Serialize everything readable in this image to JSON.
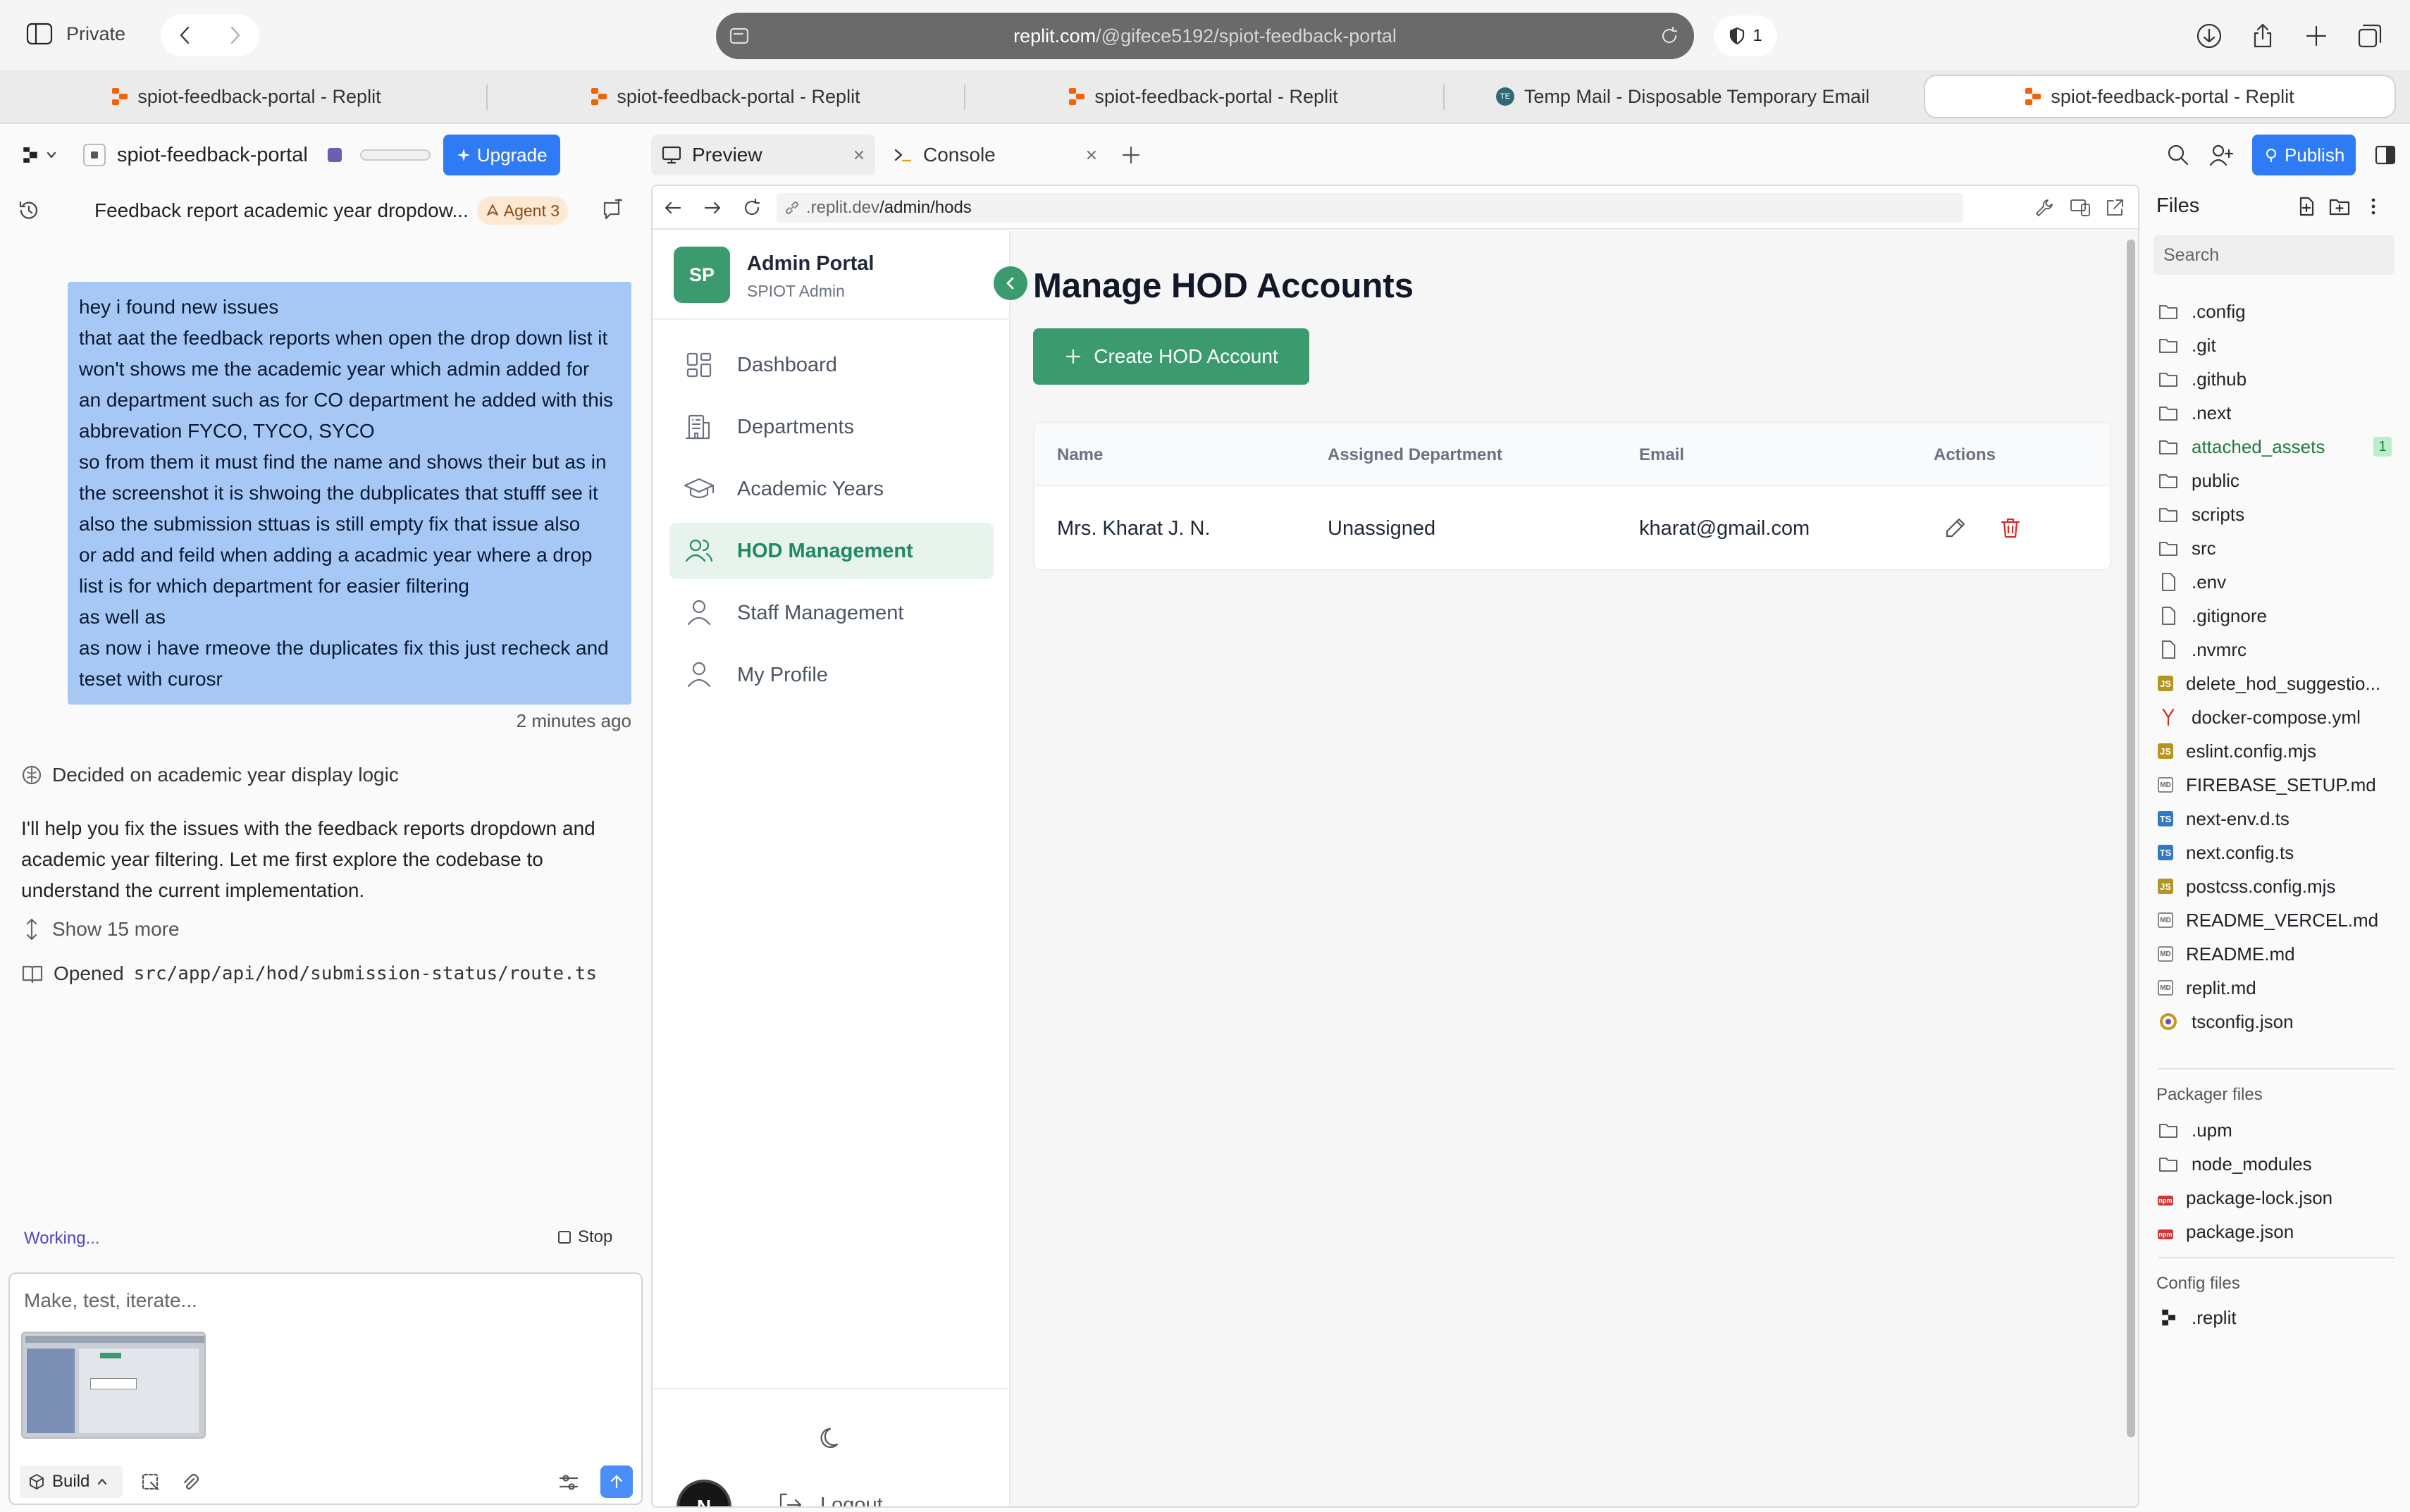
{
  "browser": {
    "private_label": "Private",
    "url_domain": "replit.com",
    "url_path": "/@gifece5192/spiot-feedback-portal",
    "shield_count": "1",
    "tabs": [
      {
        "label": "spiot-feedback-portal - Replit"
      },
      {
        "label": "spiot-feedback-portal - Replit"
      },
      {
        "label": "spiot-feedback-portal - Replit"
      },
      {
        "label": "Temp Mail - Disposable Temporary Email"
      },
      {
        "label": "spiot-feedback-portal - Replit"
      }
    ]
  },
  "workspace": {
    "project_name": "spiot-feedback-portal",
    "upgrade_label": "Upgrade",
    "publish_label": "Publish",
    "preview_tab": "Preview",
    "console_tab": "Console"
  },
  "chat": {
    "title": "Feedback report academic year dropdow...",
    "agent_badge": "Agent 3",
    "user_message": [
      "hey i found new issues",
      "that aat the feedback reports when open the drop down list it",
      "won't shows me the academic year which admin added for",
      "an department such as for CO department he added with this",
      "abbrevation FYCO, TYCO, SYCO",
      "so from them it must find the name and shows their but as in",
      "the screenshot it is shwoing the dubplicates that stufff see it",
      "also the submission sttuas is still empty fix that issue also",
      "or add and feild when adding a acadmic year where a drop",
      "list is for which department for easier filtering",
      "as well as",
      "as now i have rmeove the duplicates fix this just recheck and",
      "teset with curosr"
    ],
    "timestamp": "2 minutes ago",
    "decision": "Decided on academic year display logic",
    "reply": [
      "I'll help you fix the issues with the feedback reports dropdown and",
      "academic year filtering. Let me first explore the codebase to",
      "understand the current implementation."
    ],
    "show_more": "Show 15 more",
    "opened_prefix": "Opened",
    "opened_path": "src/app/api/hod/submission-status/route.ts",
    "working": "Working...",
    "stop": "Stop",
    "input_placeholder": "Make, test, iterate...",
    "build_label": "Build"
  },
  "preview": {
    "url_prefix": ".replit.dev",
    "url_path": "/admin/hods",
    "brand": {
      "initials": "SP",
      "title": "Admin Portal",
      "subtitle": "SPIOT Admin"
    },
    "nav": [
      {
        "label": "Dashboard",
        "icon": "grid-icon"
      },
      {
        "label": "Departments",
        "icon": "building-icon"
      },
      {
        "label": "Academic Years",
        "icon": "graduation-cap-icon"
      },
      {
        "label": "HOD Management",
        "icon": "users-icon",
        "active": true
      },
      {
        "label": "Staff Management",
        "icon": "user-icon"
      },
      {
        "label": "My Profile",
        "icon": "user-icon"
      }
    ],
    "logout": "Logout",
    "avatar_letter": "N",
    "page_title": "Manage HOD Accounts",
    "create_button": "Create HOD Account",
    "table": {
      "headers": [
        "Name",
        "Assigned Department",
        "Email",
        "Actions"
      ],
      "rows": [
        {
          "name": "Mrs. Kharat J. N.",
          "department": "Unassigned",
          "email": "kharat@gmail.com"
        }
      ]
    }
  },
  "files": {
    "title": "Files",
    "search_placeholder": "Search",
    "items": [
      {
        "name": ".config",
        "type": "folder"
      },
      {
        "name": ".git",
        "type": "folder"
      },
      {
        "name": ".github",
        "type": "folder"
      },
      {
        "name": ".next",
        "type": "folder"
      },
      {
        "name": "attached_assets",
        "type": "folder",
        "badge": "1"
      },
      {
        "name": "public",
        "type": "folder"
      },
      {
        "name": "scripts",
        "type": "folder"
      },
      {
        "name": "src",
        "type": "folder"
      },
      {
        "name": ".env",
        "type": "file"
      },
      {
        "name": ".gitignore",
        "type": "file"
      },
      {
        "name": ".nvmrc",
        "type": "file"
      },
      {
        "name": "delete_hod_suggestio...",
        "type": "js"
      },
      {
        "name": "docker-compose.yml",
        "type": "yml"
      },
      {
        "name": "eslint.config.mjs",
        "type": "js"
      },
      {
        "name": "FIREBASE_SETUP.md",
        "type": "md"
      },
      {
        "name": "next-env.d.ts",
        "type": "ts"
      },
      {
        "name": "next.config.ts",
        "type": "ts"
      },
      {
        "name": "postcss.config.mjs",
        "type": "js"
      },
      {
        "name": "README_VERCEL.md",
        "type": "md"
      },
      {
        "name": "README.md",
        "type": "md"
      },
      {
        "name": "replit.md",
        "type": "md"
      },
      {
        "name": "tsconfig.json",
        "type": "json"
      }
    ],
    "packager_title": "Packager files",
    "packager": [
      {
        "name": ".upm",
        "type": "folder"
      },
      {
        "name": "node_modules",
        "type": "folder"
      },
      {
        "name": "package-lock.json",
        "type": "npm"
      },
      {
        "name": "package.json",
        "type": "npm"
      }
    ],
    "config_title": "Config files",
    "config": [
      {
        "name": ".replit",
        "type": "replit"
      }
    ]
  },
  "colors": {
    "accent": "#3b9b6f",
    "brand_blue": "#2f7bf5",
    "danger": "#dc2626",
    "message_bg": "#a7c8f5"
  }
}
